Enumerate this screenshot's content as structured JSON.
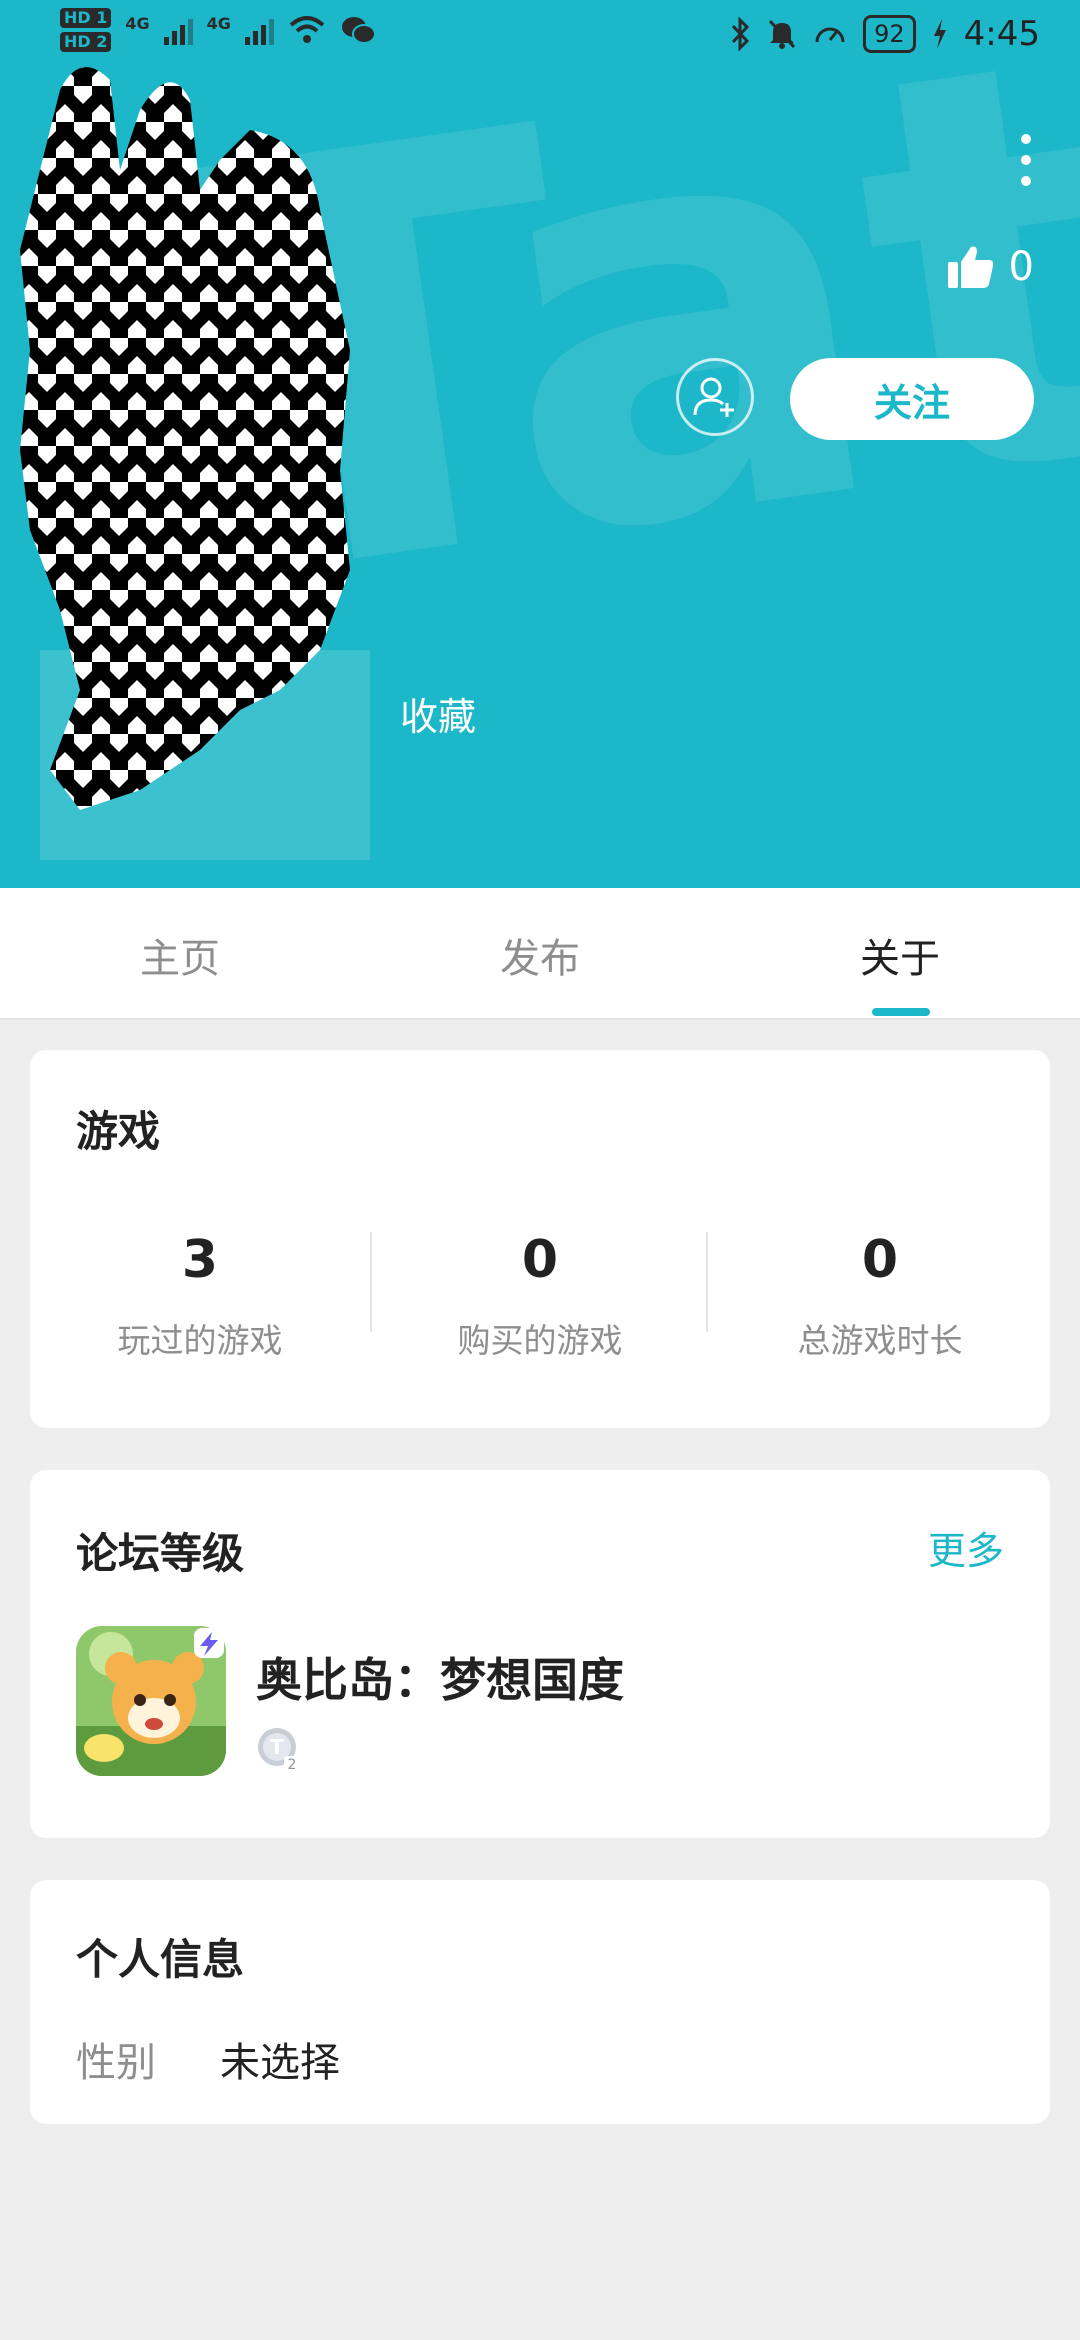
{
  "status_bar": {
    "sim1": "HD 1",
    "sim2": "HD 2",
    "network1": "4G",
    "network2": "4G",
    "battery": "92",
    "time": "4:45"
  },
  "profile": {
    "like_count": "0",
    "follow_label": "关注",
    "collect_label": "收藏"
  },
  "tabs": [
    {
      "label": "主页",
      "active": false
    },
    {
      "label": "发布",
      "active": false
    },
    {
      "label": "关于",
      "active": true
    }
  ],
  "games_card": {
    "title": "游戏",
    "stats": [
      {
        "value": "3",
        "label": "玩过的游戏"
      },
      {
        "value": "0",
        "label": "购买的游戏"
      },
      {
        "value": "0",
        "label": "总游戏时长"
      }
    ]
  },
  "forum_card": {
    "title": "论坛等级",
    "more_label": "更多",
    "game_name": "奥比岛：梦想国度",
    "level_badge": "T2"
  },
  "personal_card": {
    "title": "个人信息",
    "gender_label": "性别",
    "gender_value": "未选择"
  },
  "colors": {
    "accent": "#1cb7c8",
    "page_bg": "#eeeeee"
  }
}
